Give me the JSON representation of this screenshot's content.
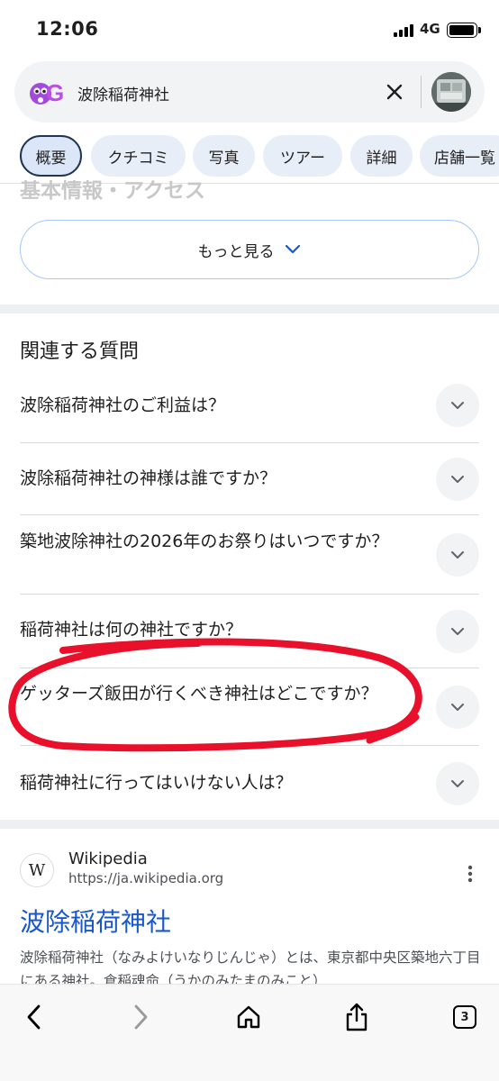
{
  "status_bar": {
    "time": "12:06",
    "network": "4G"
  },
  "search": {
    "query": "波除稲荷神社"
  },
  "tabs": [
    {
      "label": "概要",
      "active": true
    },
    {
      "label": "クチコミ",
      "active": false
    },
    {
      "label": "写真",
      "active": false
    },
    {
      "label": "ツアー",
      "active": false
    },
    {
      "label": "詳細",
      "active": false
    },
    {
      "label": "店舗一覧",
      "active": false
    }
  ],
  "section_heading": "基本情報・アクセス",
  "more_button": {
    "label": "もっと見る"
  },
  "related_questions": {
    "title": "関連する質問",
    "items": [
      "波除稲荷神社のご利益は？",
      "波除稲荷神社の神様は誰ですか？",
      "築地波除神社の2026年のお祭りはいつですか？",
      "稲荷神社は何の神社ですか？",
      "ゲッターズ飯田が行くべき神社はどこですか？",
      "稲荷神社に行ってはいけない人は？"
    ]
  },
  "result": {
    "favicon": "W",
    "site_name": "Wikipedia",
    "url": "https://ja.wikipedia.org",
    "title": "波除稲荷神社",
    "snippet": "波除稲荷神社（なみよけいなりじんじゃ）とは、東京都中央区築地六丁目にある神社。倉稲魂命（うかのみたまのみこと）"
  },
  "toolbar": {
    "tab_count": "3"
  },
  "colors": {
    "link": "#1a57c8",
    "annotation": "#e8102a",
    "chip_bg": "#e8eef8"
  }
}
